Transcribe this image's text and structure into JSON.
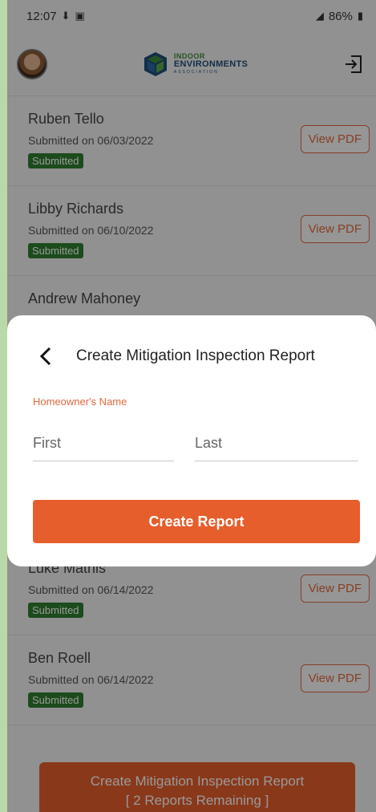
{
  "status_bar": {
    "time": "12:07",
    "battery": "86%"
  },
  "header": {
    "logo_line1": "INDOOR",
    "logo_line2": "ENVIRONMENTS",
    "logo_line3": "ASSOCIATION"
  },
  "reports": [
    {
      "name": "Ruben Tello",
      "date": "Submitted on 06/03/2022",
      "status": "Submitted",
      "action": "View PDF"
    },
    {
      "name": "Libby Richards",
      "date": "Submitted on 06/10/2022",
      "status": "Submitted",
      "action": "View PDF"
    },
    {
      "name": "Andrew Mahoney",
      "date": "",
      "status": "",
      "action": ""
    },
    {
      "name": "",
      "date": "",
      "status": "",
      "action": ""
    },
    {
      "name": "",
      "date": "",
      "status": "",
      "action": ""
    },
    {
      "name": "Luke Mathis",
      "date": "Submitted on 06/14/2022",
      "status": "Submitted",
      "action": "View PDF"
    },
    {
      "name": "Ben Roell",
      "date": "Submitted on 06/14/2022",
      "status": "Submitted",
      "action": "View PDF"
    }
  ],
  "bottom_cta": {
    "line1": "Create Mitigation Inspection Report",
    "line2": "[ 2 Reports Remaining ]"
  },
  "modal": {
    "title": "Create Mitigation Inspection Report",
    "field_label": "Homeowner's Name",
    "first_placeholder": "First",
    "last_placeholder": "Last",
    "submit_label": "Create Report"
  },
  "colors": {
    "accent": "#e55e2c",
    "badge": "#2f7d2f",
    "background_strip": "#b9d9a8"
  },
  "icons": [
    "avatar",
    "logo-icon",
    "logout-icon",
    "back-icon"
  ]
}
